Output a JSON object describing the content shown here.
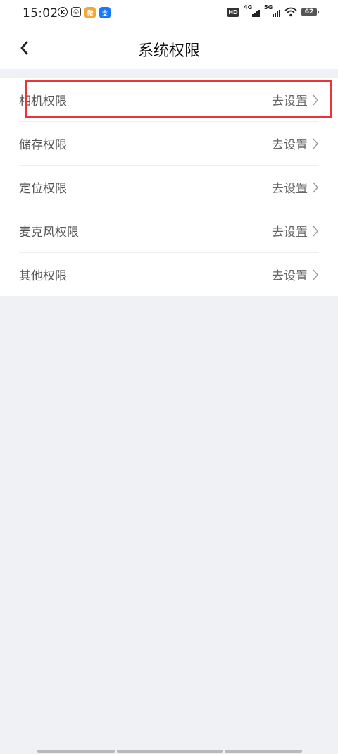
{
  "status_bar": {
    "time": "15:02",
    "app_icons": [
      {
        "name": "k-app-icon",
        "glyph": "K",
        "color": "#222222"
      },
      {
        "name": "camera-app-icon",
        "glyph": "◎",
        "color": "#333333"
      },
      {
        "name": "weibo-icon",
        "glyph": "微",
        "color": "#f2a93b"
      },
      {
        "name": "alipay-icon",
        "glyph": "支",
        "color": "#1677ff"
      }
    ],
    "hd_label": "HD",
    "signal_1_label": "4G",
    "signal_2_label": "5G",
    "battery_level": "62"
  },
  "navbar": {
    "title": "系统权限",
    "back_icon": "chevron-left-icon"
  },
  "permissions": [
    {
      "label": "相机权限",
      "action": "去设置"
    },
    {
      "label": "储存权限",
      "action": "去设置"
    },
    {
      "label": "定位权限",
      "action": "去设置"
    },
    {
      "label": "麦克风权限",
      "action": "去设置"
    },
    {
      "label": "其他权限",
      "action": "去设置"
    }
  ],
  "colors": {
    "highlight": "#e8343d",
    "background": "#f0f1f5"
  }
}
